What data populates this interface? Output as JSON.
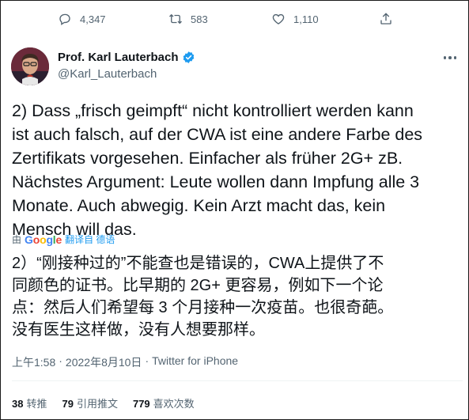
{
  "previous_tweet_actions": {
    "reply_count": "4,347",
    "retweet_count": "583",
    "like_count": "1,110",
    "icons": [
      "reply-icon",
      "retweet-icon",
      "like-icon",
      "share-icon"
    ]
  },
  "author": {
    "display_name": "Prof. Karl Lauterbach",
    "handle": "@Karl_Lauterbach",
    "verified_color": "#1d9bf0"
  },
  "tweet": {
    "text": "2) Dass „frisch geimpft“ nicht kontrolliert werden kann\nist auch falsch, auf der CWA ist eine andere Farbe des\nZertifikats vorgesehen. Einfacher als früher 2G+ zB.\nNächstes Argument: Leute wollen dann Impfung alle 3\nMonate. Auch abwegig. Kein Arzt macht das, kein\nMensch will das.",
    "translated_by_prefix": "由",
    "google_letters": [
      "G",
      "o",
      "o",
      "g",
      "l",
      "e"
    ],
    "translated_from_label": "翻译自 德语",
    "translation": "2）“刚接种过的”不能查也是错误的，CWA上提供了不\n同颜色的证书。比早期的 2G+ 更容易，例如下一个论\n点：然后人们希望每 3 个月接种一次疫苗。也很奇葩。\n没有医生这样做，没有人想要那样。"
  },
  "meta": {
    "time": "上午1:58",
    "separator1": "·",
    "date": "2022年8月10日",
    "separator2": "·",
    "source": "Twitter for iPhone"
  },
  "stats": {
    "retweets_value": "38",
    "retweets_label": "转推",
    "quotes_value": "79",
    "quotes_label": "引用推文",
    "likes_value": "779",
    "likes_label": "喜欢次数"
  }
}
